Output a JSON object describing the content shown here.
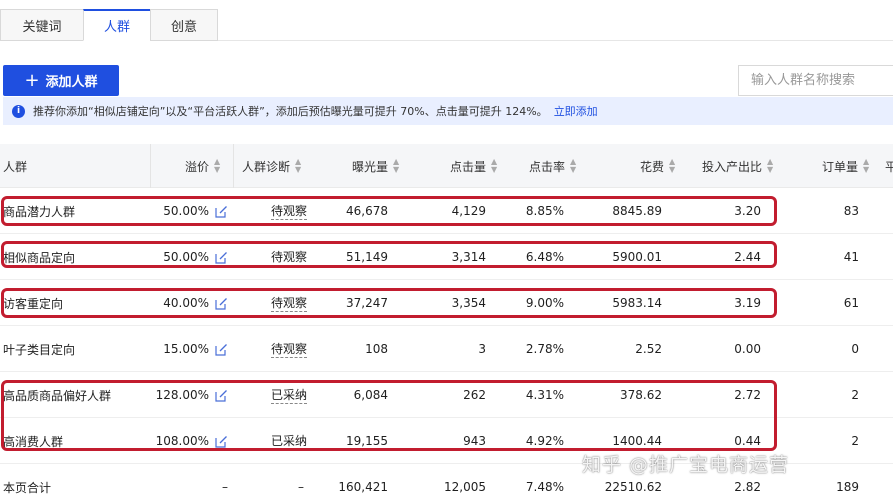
{
  "tabs": [
    {
      "label": "关键词"
    },
    {
      "label": "人群"
    },
    {
      "label": "创意"
    }
  ],
  "toolbar": {
    "add_label": "添加人群",
    "search_placeholder": "输入人群名称搜索"
  },
  "tip": {
    "text": "推荐你添加“相似店铺定向”以及“平台活跃人群”，添加后预估曝光量可提升 70%、点击量可提升 124%。",
    "link": "立即添加"
  },
  "columns": [
    "人群",
    "溢价",
    "人群诊断",
    "曝光量",
    "点击量",
    "点击率",
    "花费",
    "投入产出比",
    "订单量",
    "平"
  ],
  "rows": [
    {
      "name": "商品潜力人群",
      "premium": "50.00%",
      "diagnosis": "待观察",
      "impressions": "46,678",
      "clicks": "4,129",
      "ctr": "8.85%",
      "cost": "8845.89",
      "roi": "3.20",
      "orders": "83"
    },
    {
      "name": "相似商品定向",
      "premium": "50.00%",
      "diagnosis": "待观察",
      "impressions": "51,149",
      "clicks": "3,314",
      "ctr": "6.48%",
      "cost": "5900.01",
      "roi": "2.44",
      "orders": "41"
    },
    {
      "name": "访客重定向",
      "premium": "40.00%",
      "diagnosis": "待观察",
      "impressions": "37,247",
      "clicks": "3,354",
      "ctr": "9.00%",
      "cost": "5983.14",
      "roi": "3.19",
      "orders": "61"
    },
    {
      "name": "叶子类目定向",
      "premium": "15.00%",
      "diagnosis": "待观察",
      "impressions": "108",
      "clicks": "3",
      "ctr": "2.78%",
      "cost": "2.52",
      "roi": "0.00",
      "orders": "0"
    },
    {
      "name": "高品质商品偏好人群",
      "premium": "128.00%",
      "diagnosis": "已采纳",
      "impressions": "6,084",
      "clicks": "262",
      "ctr": "4.31%",
      "cost": "378.62",
      "roi": "2.72",
      "orders": "2"
    },
    {
      "name": "高消费人群",
      "premium": "108.00%",
      "diagnosis": "已采纳",
      "impressions": "19,155",
      "clicks": "943",
      "ctr": "4.92%",
      "cost": "1400.44",
      "roi": "0.44",
      "orders": "2"
    }
  ],
  "total": {
    "name": "本页合计",
    "premium": "–",
    "diagnosis": "–",
    "impressions": "160,421",
    "clicks": "12,005",
    "ctr": "7.48%",
    "cost": "22510.62",
    "roi": "2.82",
    "orders": "189"
  },
  "watermark": "知乎 @推广宝电商运营",
  "colors": {
    "accent": "#1f4fe0",
    "highlight": "#c21d2f",
    "tip_bg": "#e9efff"
  },
  "icons": {
    "add": "plus-icon",
    "info": "info-icon",
    "edit": "edit-icon",
    "sort": "sort-icon"
  }
}
